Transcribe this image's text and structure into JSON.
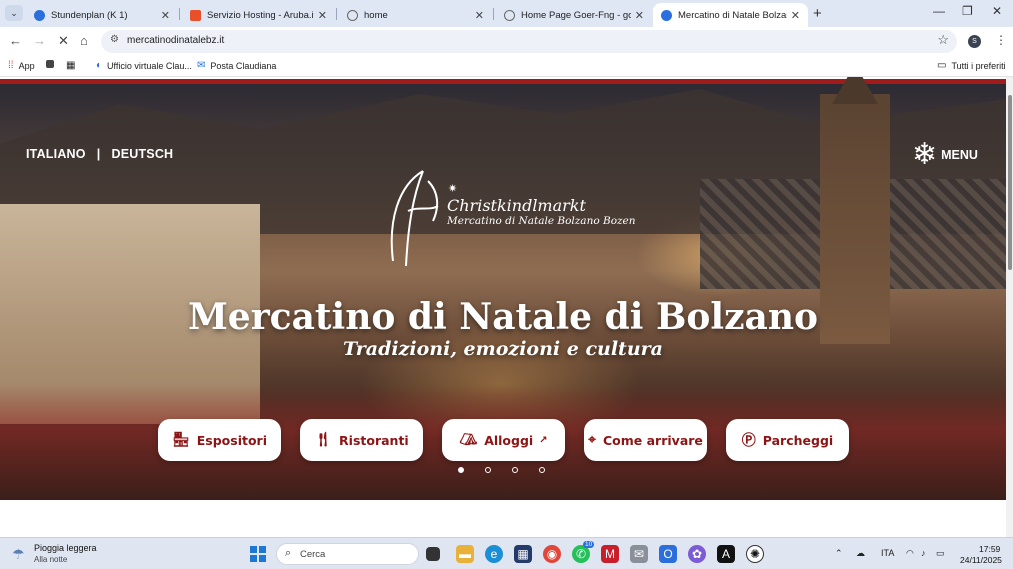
{
  "browser": {
    "tabs": [
      {
        "title": "Stundenplan (K 1)",
        "favicon_color": "#2a6fdb"
      },
      {
        "title": "Servizio Hosting - Aruba.it",
        "favicon_color": "#e8502a"
      },
      {
        "title": "home",
        "favicon_color": "#666666"
      },
      {
        "title": "Home Page Goer-Fng - goer-fng",
        "favicon_color": "#666666"
      },
      {
        "title": "Mercatino di Natale Bolzano - B",
        "favicon_color": "#2a6fdb"
      }
    ],
    "address": "mercatinodinatalebz.it",
    "profile_initial": "S",
    "bookmarks": [
      {
        "label": "App",
        "icon": "apps-icon"
      },
      {
        "label": "",
        "icon": "square-icon"
      },
      {
        "label": "",
        "icon": "grid-icon"
      },
      {
        "label": "Ufficio virtuale Clau...",
        "icon": "office-icon"
      },
      {
        "label": "Posta Claudiana",
        "icon": "mail-icon"
      }
    ],
    "all_bookmarks": "Tutti i preferiti"
  },
  "site": {
    "lang_it": "ITALIANO",
    "lang_sep": "|",
    "lang_de": "DEUTSCH",
    "menu_label": "MENU",
    "logo_title": "Christkindlmarkt",
    "logo_subtitle": "Mercatino di Natale Bolzano Bozen",
    "headline": "Mercatino di Natale di Bolzano",
    "subheadline": "Tradizioni, emozioni e cultura",
    "quick_links": [
      {
        "label": "Espositori",
        "icon": "shop-icon"
      },
      {
        "label": "Ristoranti",
        "icon": "cutlery-icon"
      },
      {
        "label": "Alloggi",
        "icon": "bed-icon"
      },
      {
        "label": "Come arrivare",
        "icon": "location-pin-icon"
      },
      {
        "label": "Parcheggi",
        "icon": "parking-icon"
      }
    ],
    "accent_color": "#8c1414"
  },
  "taskbar": {
    "weather_title": "Pioggia leggera",
    "weather_sub": "Alla notte",
    "search_placeholder": "Cerca",
    "lang": "ITA",
    "time": "17:59",
    "date": "24/11/2025",
    "whatsapp_badge": "10"
  }
}
